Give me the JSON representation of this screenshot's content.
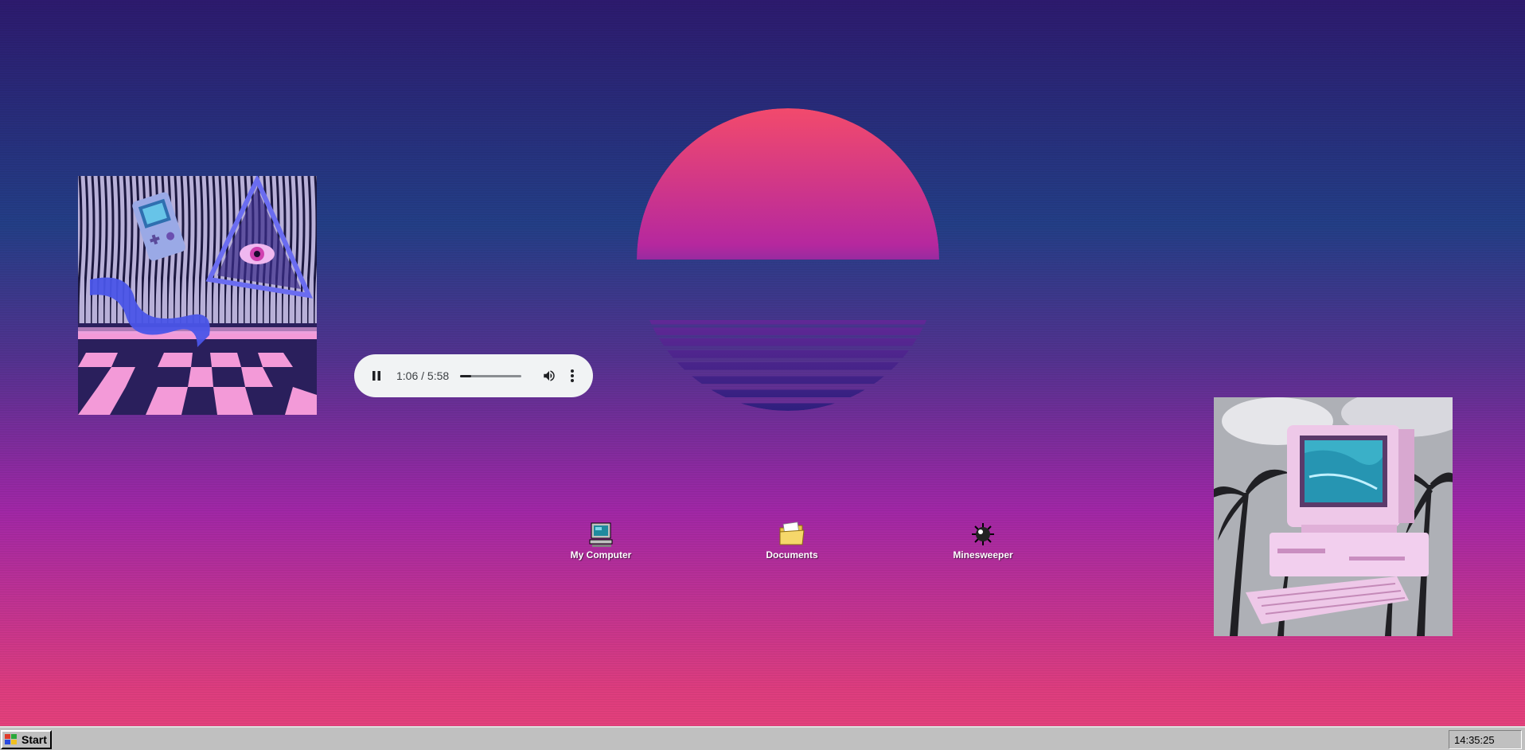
{
  "player": {
    "time_display": "1:06 / 5:58",
    "progress": 0.184,
    "state": "playing",
    "play_icon": "pause-icon",
    "volume_icon": "volume-icon",
    "menu_icon": "more-vert-icon"
  },
  "desktop_icons": [
    {
      "label": "My Computer",
      "icon": "computer-icon"
    },
    {
      "label": "Documents",
      "icon": "folder-icon"
    },
    {
      "label": "Minesweeper",
      "icon": "mine-icon"
    }
  ],
  "taskbar": {
    "start_label": "Start",
    "start_icon": "windows-logo-icon",
    "clock": "14:35:25"
  },
  "colors": {
    "sky_top": "#2d1a6e",
    "sky_bottom": "#e8427a",
    "sun_top": "#f24a6c",
    "taskbar": "#c0c0c0"
  }
}
